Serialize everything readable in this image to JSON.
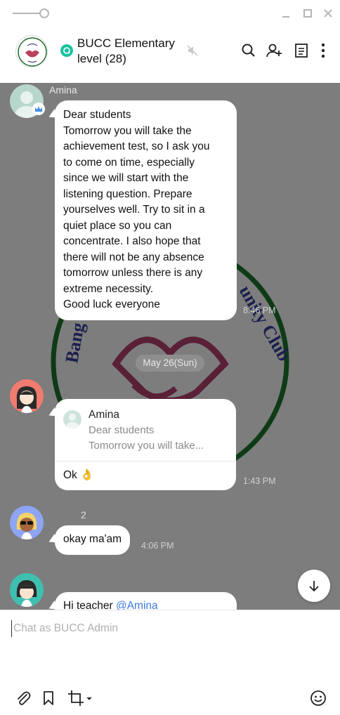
{
  "window": {
    "pin_icon": "pin-toggle-icon",
    "minimize_icon": "minimize-icon",
    "maximize_icon": "maximize-icon",
    "close_icon": "close-icon"
  },
  "header": {
    "group_name_line1": "BUCC Elementary",
    "group_name_line2": "level (28)",
    "icons": [
      "group-chat-icon",
      "mute-icon",
      "search-icon",
      "add-user-icon",
      "notes-icon",
      "more-icon"
    ]
  },
  "chat": {
    "background_color": "#7d7d7d",
    "watermark_text": "Bangladesh University Community Club",
    "messages": [
      {
        "sender": "Amina",
        "lines": [
          "Dear students",
          "Tomorrow you will take the",
          "achievement test, so I ask you",
          "to come on time, especially",
          "since we will start with the",
          "listening question. Prepare",
          "yourselves well. Try to sit in a",
          "quiet place so you can",
          "concentrate. I also hope that",
          "there will not be any absence",
          "tomorrow unless there is any",
          "extreme necessity.",
          "Good luck everyone"
        ],
        "time": "8:46 PM"
      }
    ],
    "date_divider": "May 26(Sun)",
    "reply_message": {
      "quoted_author": "Amina",
      "quoted_line1": "Dear students",
      "quoted_line2": "Tomorrow you will take...",
      "text": "Ok",
      "emoji": "👌",
      "time": "1:43 PM"
    },
    "okay_message": {
      "unread_count": "2",
      "text": "okay ma'am",
      "time": "4:06 PM"
    },
    "last_message": {
      "text_prefix": "Hi teacher ",
      "mention": "@Amina"
    }
  },
  "composer": {
    "placeholder": "Chat as BUCC Admin",
    "value": "",
    "icons": [
      "attach-icon",
      "bookmark-icon",
      "crop-icon",
      "emoji-icon"
    ]
  }
}
